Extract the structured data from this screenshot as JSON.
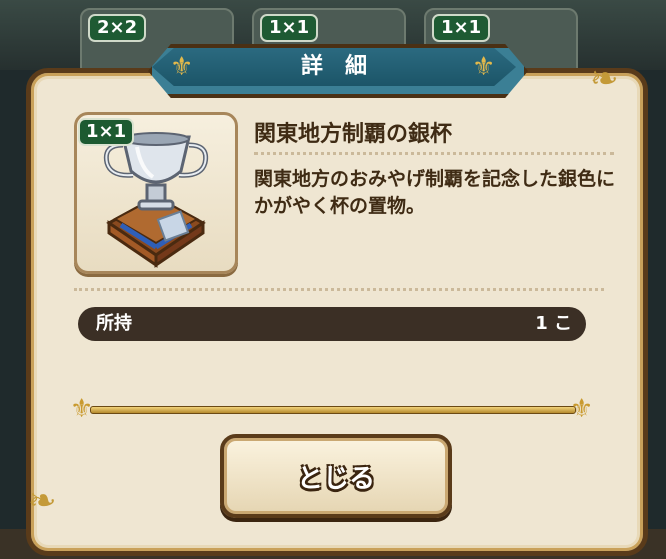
{
  "background": {
    "slots": [
      {
        "size": "2×2"
      },
      {
        "size": "1×1"
      },
      {
        "size": "1×1"
      }
    ]
  },
  "dialog": {
    "title": "詳細",
    "item": {
      "size_badge": "1×1",
      "name": "関東地方制覇の銀杯",
      "description": "関東地方のおみやげ制覇を記念した銀色にかがやく杯の置物。",
      "icon": "silver-trophy-icon"
    },
    "owned": {
      "label": "所持",
      "value": "1 こ"
    },
    "close_label": "とじる"
  },
  "colors": {
    "panel": "#efe6d2",
    "frame": "#5a3b1a",
    "title_bar": "#2b6a80",
    "gold": "#c99a2e",
    "badge_green": "#1d5a31",
    "owned_bar": "#3b2f25"
  }
}
